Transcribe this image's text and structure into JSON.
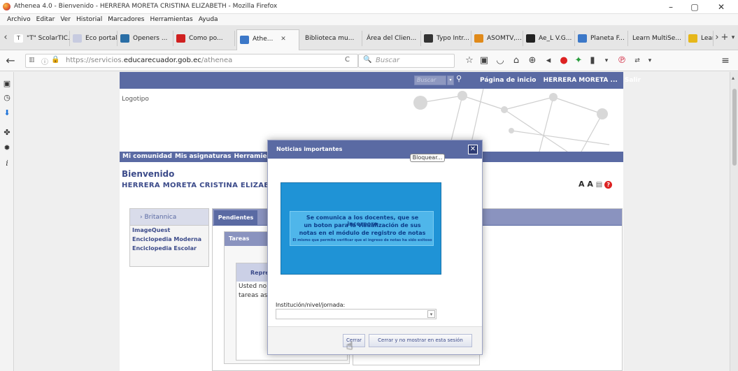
{
  "window": {
    "title": "Athenea 4.0 - Bienvenido - HERRERA MORETA CRISTINA ELIZABETH - Mozilla Firefox",
    "minimize": "–",
    "maximize": "▢",
    "close": "✕"
  },
  "menubar": [
    "Archivo",
    "Editar",
    "Ver",
    "Historial",
    "Marcadores",
    "Herramientas",
    "Ayuda"
  ],
  "tabs": [
    {
      "label": "\"T\" ScolarTIC...",
      "color": "#444444"
    },
    {
      "label": "Eco portal",
      "color": "#5a6aa3"
    },
    {
      "label": "Openers ...",
      "color": "#2a6ea6"
    },
    {
      "label": "Como po...",
      "color": "#d02020"
    },
    {
      "label": "Athe...",
      "color": "#3c78c8",
      "active": true,
      "close": "✕"
    },
    {
      "label": "Biblioteca mu...",
      "color": "#999999"
    },
    {
      "label": "Área del Clien...",
      "color": "#999999"
    },
    {
      "label": "Typo Intr...",
      "color": "#333333"
    },
    {
      "label": "ASOMTV,...",
      "color": "#e08a1a"
    },
    {
      "label": "Ae_L V.G...",
      "color": "#222222"
    },
    {
      "label": "Planeta F...",
      "color": "#3c78c8"
    },
    {
      "label": "Learn MultiSe...",
      "color": "#999999"
    },
    {
      "label": "Learn",
      "color": "#e6b71a"
    }
  ],
  "tabstrip_controls": {
    "scroll_left": "‹",
    "scroll_right": "›",
    "new_tab": "+",
    "list": "▾"
  },
  "nav": {
    "url_prefix": "https://servicios.",
    "url_domain": "educarecuador.gob.ec",
    "url_path": "/athenea",
    "reload": "C",
    "search_placeholder": "Buscar"
  },
  "site": {
    "search_placeholder": "Buscar",
    "nav": [
      "Página de inicio",
      "HERRERA MORETA ...",
      "Salir"
    ],
    "logo_text": "Logotipo",
    "main_nav": [
      "Mi comunidad",
      "Mis asignaturas",
      "Herramientas"
    ],
    "welcome": "Bienvenido",
    "username": "HERRERA MORETA CRISTINA ELIZABETH",
    "tools": "A A",
    "help": "?",
    "left_menu_head": "› Britannica",
    "left_menu_items": [
      "ImageQuest",
      "Enciclopedia Moderna",
      "Enciclopedia Escolar"
    ],
    "panel_tab": "Pendientes",
    "tareas_header": "Tareas",
    "rep_header": "Represen",
    "rep_text_1": "Usted no tie",
    "rep_text_2": "tareas asign"
  },
  "modal": {
    "title": "Noticias importantes",
    "close": "✕",
    "block_label": "Bloquear...",
    "notice_line1": "Se comunica a los docentes, que se incorporo",
    "notice_line2": "un boton para la visualización de sus",
    "notice_line3": "notas en el módulo de registro de notas",
    "notice_line4": "El mismo que permite verificar que el ingreso de notas ha sido exitoso",
    "field_label": "Institución/nivel/jornada:",
    "select_value": "",
    "btn_close": "Cerrar",
    "btn_close_nomore": "Cerrar y no mostrar en esta sesión"
  }
}
